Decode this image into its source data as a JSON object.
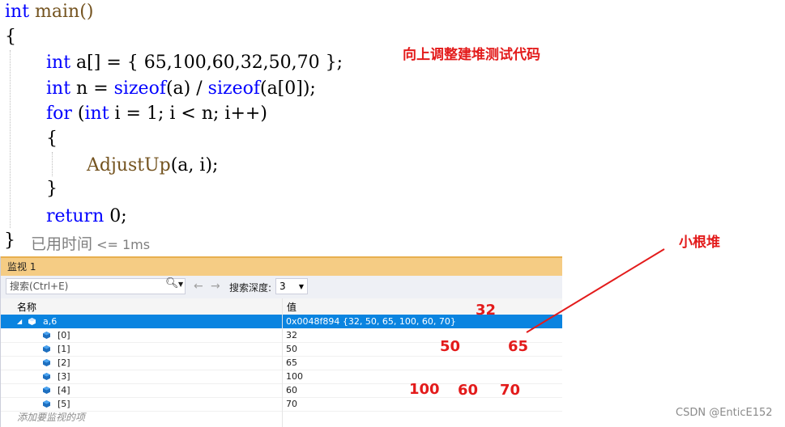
{
  "code": {
    "line1": "main()",
    "kw_int": "int",
    "brace_open": "{",
    "brace_close": "}",
    "line3_rest": " a[] = { 65,100,60,32,50,70 };",
    "line4_rest": " n = ",
    "sizeof": "sizeof",
    "line4_a": "(a) / ",
    "line4_b": "(a[0]);",
    "kw_for": "for",
    "line5_a": " (",
    "line5_b": " i = 1; i < n; i++)",
    "adjust_fn": "AdjustUp",
    "adjust_args": "(a, i);",
    "kw_return": "return",
    "return_val": " 0;",
    "elapsed_label": "已用时间",
    "elapsed_value": " <= 1ms"
  },
  "annotations": {
    "upward_note": "向上调整建堆测试代码",
    "min_heap": "小根堆",
    "heap_nodes": [
      "32",
      "50",
      "65",
      "100",
      "60",
      "70"
    ]
  },
  "watch": {
    "title": "监视 1",
    "search_placeholder": "搜索(Ctrl+E)",
    "search_depth_label": "搜索深度:",
    "search_depth_value": "3",
    "col_name": "名称",
    "col_value": "值",
    "root_name": "a,6",
    "root_value": "0x0048f894 {32, 50, 65, 100, 60, 70}",
    "rows": [
      {
        "name": "[0]",
        "value": "32"
      },
      {
        "name": "[1]",
        "value": "50"
      },
      {
        "name": "[2]",
        "value": "65"
      },
      {
        "name": "[3]",
        "value": "100"
      },
      {
        "name": "[4]",
        "value": "60"
      },
      {
        "name": "[5]",
        "value": "70"
      }
    ],
    "add_item": "添加要监视的项"
  },
  "watermark": "CSDN @EnticE152",
  "colors": {
    "keyword": "#0000ff",
    "annotation": "#e31b1b",
    "selected_row": "#0a84e0",
    "tab_title": "#f5cc84"
  }
}
